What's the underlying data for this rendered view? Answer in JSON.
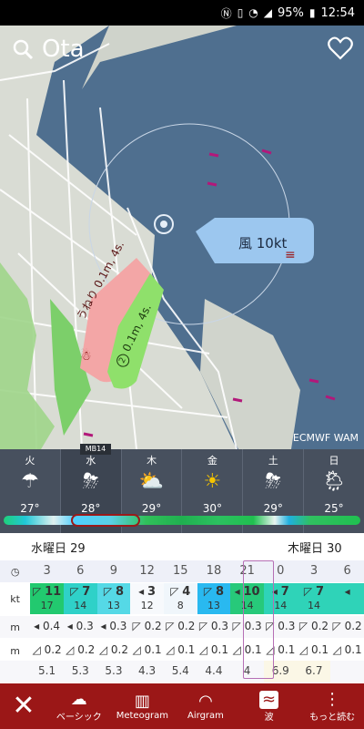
{
  "status_bar": {
    "battery": "95%",
    "time": "12:54"
  },
  "search": {
    "location": "Ota"
  },
  "map": {
    "wind_label": "風 10kt",
    "swell_label": "うねり",
    "swell_value": "0.1m, 4s.",
    "wave_value": "0.1m, 4s.",
    "wave_badge": "2",
    "credit": "ECMWF WAM",
    "colors": {
      "sea": "#4f6f8f",
      "land": "#d9dcd4",
      "wind_bubble": "#9cc7ef",
      "swell_bubble": "#f3a6a6",
      "wave_bubble": "#8fe06b"
    }
  },
  "days_strip": {
    "logo": "MB14",
    "days": [
      {
        "label": "火",
        "icon": "cloud-rain",
        "temp": "27°"
      },
      {
        "label": "水",
        "icon": "thunder-rain",
        "temp": "28°"
      },
      {
        "label": "木",
        "icon": "sun-cloud",
        "temp": "29°"
      },
      {
        "label": "金",
        "icon": "sun",
        "temp": "30°"
      },
      {
        "label": "土",
        "icon": "thunder-rain",
        "temp": "29°"
      },
      {
        "label": "日",
        "icon": "sun-rain",
        "temp": "25°"
      }
    ]
  },
  "table": {
    "date_left": "水曜日 29",
    "date_right": "木曜日 30",
    "row_labels": {
      "wind": "kt",
      "swell": "m",
      "wave": "m"
    },
    "hours": [
      "3",
      "6",
      "9",
      "12",
      "15",
      "18",
      "21",
      "0",
      "3",
      "6"
    ],
    "wind": [
      {
        "speed": "11",
        "gust": "17",
        "arrow": "◸"
      },
      {
        "speed": "7",
        "gust": "14",
        "arrow": "◸"
      },
      {
        "speed": "8",
        "gust": "13",
        "arrow": "◸"
      },
      {
        "speed": "3",
        "gust": "12",
        "arrow": "◂"
      },
      {
        "speed": "4",
        "gust": "8",
        "arrow": "◸"
      },
      {
        "speed": "8",
        "gust": "13",
        "arrow": "◸"
      },
      {
        "speed": "10",
        "gust": "14",
        "arrow": "◂"
      },
      {
        "speed": "7",
        "gust": "14",
        "arrow": "◂"
      },
      {
        "speed": "7",
        "gust": "14",
        "arrow": "◸"
      },
      {
        "speed": "",
        "gust": "",
        "arrow": "◂"
      }
    ],
    "swell": [
      "0.4",
      "0.3",
      "0.3",
      "0.2",
      "0.2",
      "0.3",
      "0.3",
      "0.3",
      "0.2",
      "0.2"
    ],
    "wave": [
      "0.2",
      "0.2",
      "0.2",
      "0.1",
      "0.1",
      "0.1",
      "0.1",
      "0.1",
      "0.1",
      "0.1"
    ],
    "period": [
      "5.1",
      "5.3",
      "5.3",
      "4.3",
      "5.4",
      "4.4",
      "4",
      "6.9",
      "6.7",
      ""
    ]
  },
  "bottom_nav": {
    "close_icon": "close-icon",
    "items": [
      {
        "label": "ベーシック",
        "icon": "weather-icon"
      },
      {
        "label": "Meteogram",
        "icon": "chart-icon"
      },
      {
        "label": "Airgram",
        "icon": "airgram-icon"
      },
      {
        "label": "波",
        "icon": "surf-icon"
      },
      {
        "label": "もっと読む",
        "icon": "more-icon"
      }
    ]
  }
}
